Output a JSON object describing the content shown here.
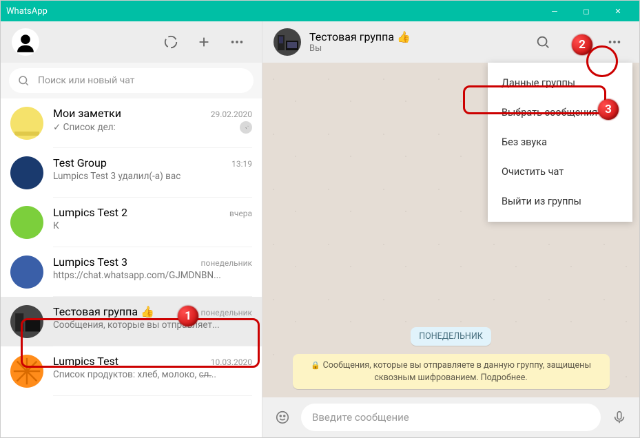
{
  "titlebar": {
    "title": "WhatsApp"
  },
  "search": {
    "placeholder": "Поиск или новый чат"
  },
  "chats": [
    {
      "name": "Мои заметки",
      "preview": "✓ Список дел:",
      "time": "29.02.2020",
      "pinned": true
    },
    {
      "name": "Test Group",
      "preview": "Lumpics Test 3 удалил(-а) вас",
      "time": "13:19"
    },
    {
      "name": "Lumpics Test 2",
      "preview": "К",
      "time": "вчера"
    },
    {
      "name": "Lumpics Test 3",
      "preview": "https://chat.whatsapp.com/GJMDNBN...",
      "time": "понедельник"
    },
    {
      "name": "Тестовая группа 👍",
      "preview": "Сообщения, которые вы отправляет...",
      "time": "понедельник",
      "selected": true
    },
    {
      "name": "Lumpics Test",
      "preview": "Список продуктов: хлеб, молоко, с̶л̶...",
      "time": "10.03.2020"
    }
  ],
  "header": {
    "group_name": "Тестовая группа 👍",
    "group_sub": "Вы"
  },
  "body": {
    "date_label": "ПОНЕДЕЛЬНИК",
    "encryption_notice": "Сообщения, которые вы отправляете в данную группу, защищены сквозным шифрованием. Подробнее."
  },
  "composer": {
    "placeholder": "Введите сообщение"
  },
  "menu": {
    "items": [
      "Данные группы",
      "Выбрать сообщения",
      "Без звука",
      "Очистить чат",
      "Выйти из группы"
    ]
  },
  "callouts": {
    "b1": "1",
    "b2": "2",
    "b3": "3"
  }
}
